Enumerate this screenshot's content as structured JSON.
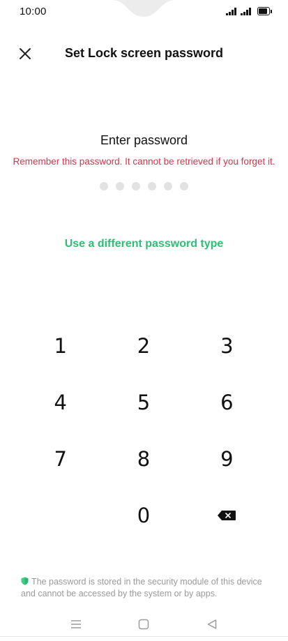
{
  "status_bar": {
    "time": "10:00",
    "icons": [
      "signal-icon",
      "signal-icon",
      "battery-icon"
    ]
  },
  "header": {
    "title": "Set Lock screen password",
    "close_icon": "close-icon"
  },
  "main": {
    "prompt": "Enter password",
    "warning": "Remember this password. It cannot be retrieved if you forget it.",
    "password_length": 6,
    "alt_type_link": "Use a different password type"
  },
  "keypad": {
    "keys": [
      "1",
      "2",
      "3",
      "4",
      "5",
      "6",
      "7",
      "8",
      "9",
      "",
      "0",
      "backspace"
    ]
  },
  "footer": {
    "note": "The password is stored in the security module of this device and cannot be accessed by the system or by apps.",
    "note_icon": "shield-icon"
  },
  "nav_bar": {
    "buttons": [
      "menu-icon",
      "home-icon",
      "back-icon"
    ]
  },
  "colors": {
    "warning": "#d9344a",
    "accent": "#2dbf74",
    "dot": "#e2e2e2",
    "note_text": "#9a9a9a"
  }
}
